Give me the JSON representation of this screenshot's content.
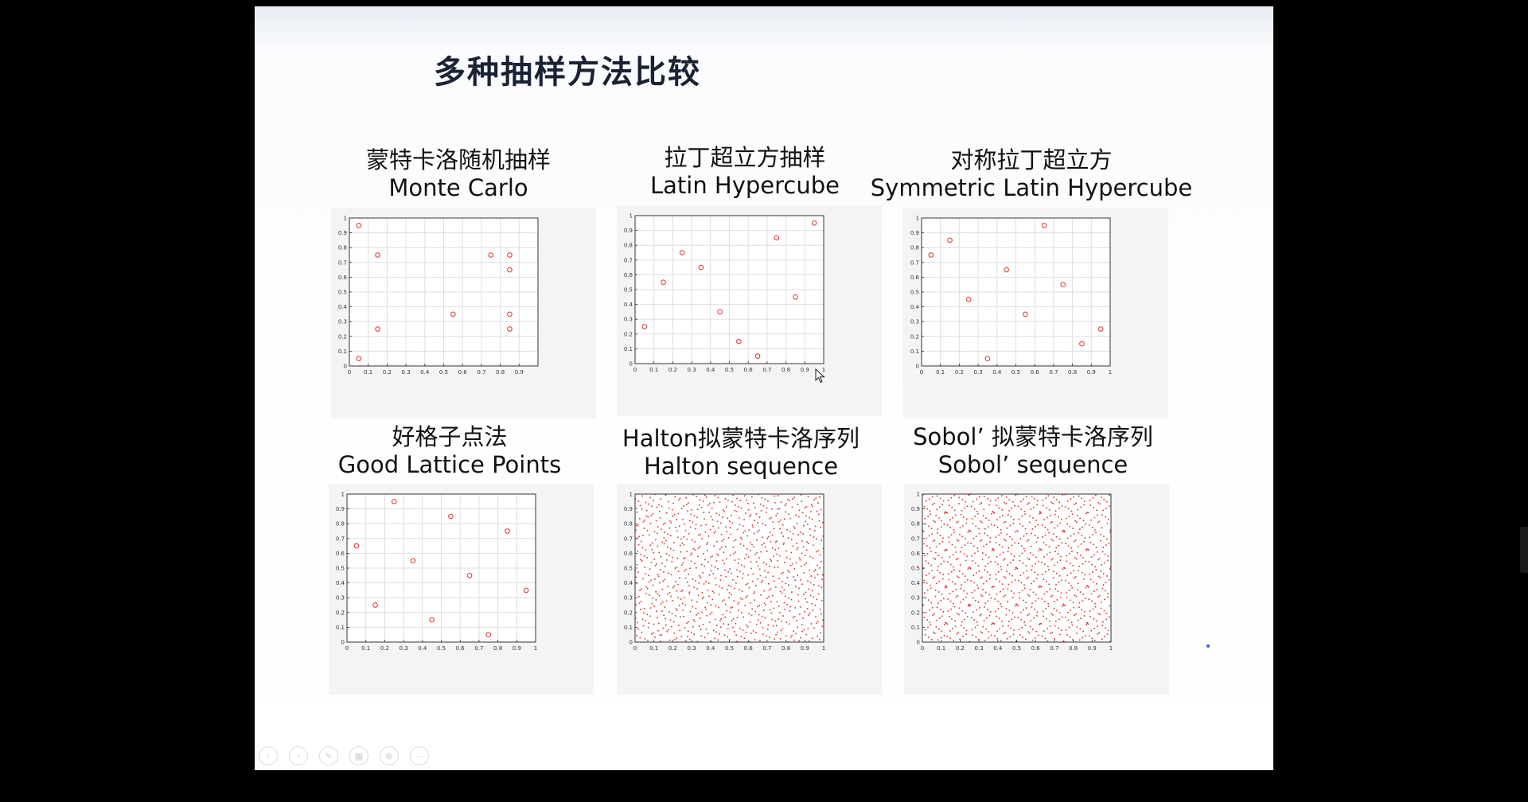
{
  "slide": {
    "title": "多种抽样方法比较",
    "toolbar_icons": [
      "prev-icon",
      "next-icon",
      "pen-icon",
      "slides-icon",
      "zoom-icon",
      "more-icon"
    ]
  },
  "chart_data": [
    {
      "id": "mc",
      "type": "scatter",
      "title_zh": "蒙特卡洛随机抽样",
      "title_en": "Monte Carlo",
      "marker": "circle",
      "color": "#e0302a",
      "xlim": [
        0,
        1
      ],
      "ylim": [
        0,
        1
      ],
      "xticks": [
        "0",
        "0.1",
        "0.2",
        "0.3",
        "0.4",
        "0.5",
        "0.6",
        "0.7",
        "0.8",
        "0.9"
      ],
      "yticks": [
        "0",
        "0.1",
        "0.2",
        "0.3",
        "0.4",
        "0.5",
        "0.6",
        "0.7",
        "0.8",
        "0.9",
        "1"
      ],
      "grid": true,
      "x": [
        0.05,
        0.15,
        0.15,
        0.55,
        0.75,
        0.85,
        0.85,
        0.85,
        0.85,
        0.05
      ],
      "y": [
        0.95,
        0.75,
        0.25,
        0.35,
        0.75,
        0.75,
        0.65,
        0.35,
        0.25,
        0.05
      ]
    },
    {
      "id": "lhs",
      "type": "scatter",
      "title_zh": "拉丁超立方抽样",
      "title_en": "Latin Hypercube",
      "marker": "circle",
      "color": "#e0302a",
      "xlim": [
        0,
        1
      ],
      "ylim": [
        0,
        1
      ],
      "xticks": [
        "0",
        "0.1",
        "0.2",
        "0.3",
        "0.4",
        "0.5",
        "0.6",
        "0.7",
        "0.8",
        "0.9",
        "1"
      ],
      "yticks": [
        "0",
        "0.1",
        "0.2",
        "0.3",
        "0.4",
        "0.5",
        "0.6",
        "0.7",
        "0.8",
        "0.9",
        "1"
      ],
      "grid": true,
      "x": [
        0.05,
        0.15,
        0.25,
        0.35,
        0.45,
        0.55,
        0.65,
        0.75,
        0.85,
        0.95
      ],
      "y": [
        0.25,
        0.55,
        0.75,
        0.65,
        0.35,
        0.15,
        0.05,
        0.85,
        0.45,
        0.95
      ]
    },
    {
      "id": "slhs",
      "type": "scatter",
      "title_zh": "对称拉丁超立方",
      "title_en": "Symmetric Latin Hypercube",
      "marker": "circle",
      "color": "#e0302a",
      "xlim": [
        0,
        1
      ],
      "ylim": [
        0,
        1
      ],
      "xticks": [
        "0",
        "0.1",
        "0.2",
        "0.3",
        "0.4",
        "0.5",
        "0.6",
        "0.7",
        "0.8",
        "0.9",
        "1"
      ],
      "yticks": [
        "0",
        "0.1",
        "0.2",
        "0.3",
        "0.4",
        "0.5",
        "0.6",
        "0.7",
        "0.8",
        "0.9",
        "1"
      ],
      "grid": true,
      "x": [
        0.05,
        0.15,
        0.25,
        0.35,
        0.45,
        0.55,
        0.65,
        0.75,
        0.85,
        0.95
      ],
      "y": [
        0.75,
        0.85,
        0.45,
        0.05,
        0.65,
        0.35,
        0.95,
        0.55,
        0.15,
        0.25
      ]
    },
    {
      "id": "glp",
      "type": "scatter",
      "title_zh": "好格子点法",
      "title_en": "Good Lattice Points",
      "marker": "circle",
      "color": "#e0302a",
      "xlim": [
        0,
        1
      ],
      "ylim": [
        0,
        1
      ],
      "xticks": [
        "0",
        "0.1",
        "0.2",
        "0.3",
        "0.4",
        "0.5",
        "0.6",
        "0.7",
        "0.8",
        "0.9",
        "1"
      ],
      "yticks": [
        "0",
        "0.1",
        "0.2",
        "0.3",
        "0.4",
        "0.5",
        "0.6",
        "0.7",
        "0.8",
        "0.9",
        "1"
      ],
      "grid": true,
      "x": [
        0.05,
        0.15,
        0.25,
        0.35,
        0.45,
        0.55,
        0.65,
        0.75,
        0.85,
        0.95
      ],
      "y": [
        0.65,
        0.25,
        0.95,
        0.55,
        0.15,
        0.85,
        0.45,
        0.05,
        0.75,
        0.35
      ]
    },
    {
      "id": "halton",
      "type": "scatter",
      "title_zh": "Halton拟蒙特卡洛序列",
      "title_en": "Halton sequence",
      "marker": "dot",
      "color": "#e0302a",
      "sequence": "halton",
      "n_points": 900,
      "xlim": [
        0,
        1
      ],
      "ylim": [
        0,
        1
      ],
      "xticks": [
        "0",
        "0.1",
        "0.2",
        "0.3",
        "0.4",
        "0.5",
        "0.6",
        "0.7",
        "0.8",
        "0.9",
        "1"
      ],
      "yticks": [
        "0",
        "0.1",
        "0.2",
        "0.3",
        "0.4",
        "0.5",
        "0.6",
        "0.7",
        "0.8",
        "0.9",
        "1"
      ],
      "grid": false
    },
    {
      "id": "sobol",
      "type": "scatter",
      "title_zh": "Sobol’ 拟蒙特卡洛序列",
      "title_en": "Sobol’   sequence",
      "marker": "dot",
      "color": "#e0302a",
      "sequence": "sobol",
      "n_points": 1000,
      "xlim": [
        0,
        1
      ],
      "ylim": [
        0,
        1
      ],
      "xticks": [
        "0",
        "0.1",
        "0.2",
        "0.3",
        "0.4",
        "0.5",
        "0.6",
        "0.7",
        "0.8",
        "0.9",
        "1"
      ],
      "yticks": [
        "0",
        "0.1",
        "0.2",
        "0.3",
        "0.4",
        "0.5",
        "0.6",
        "0.7",
        "0.8",
        "0.9",
        "1"
      ],
      "grid": false
    }
  ]
}
